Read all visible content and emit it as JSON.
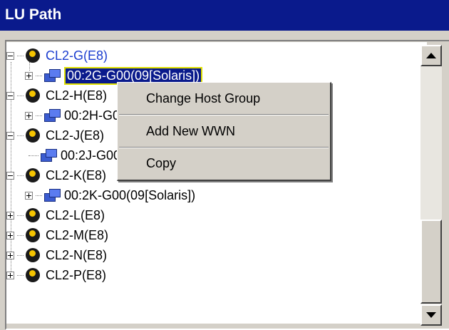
{
  "window": {
    "title": "LU Path"
  },
  "tree": {
    "nodes": [
      {
        "label": "CL2-G(E8)",
        "type": "port",
        "expander": "minus",
        "highlight": true
      },
      {
        "label": "00:2G-G00(09[Solaris])",
        "type": "host",
        "expander": "plus",
        "selected": true
      },
      {
        "label": "CL2-H(E8)",
        "type": "port",
        "expander": "minus"
      },
      {
        "label": "00:2H-G00(09[Solaris])",
        "type": "host",
        "expander": "plus"
      },
      {
        "label": "CL2-J(E8)",
        "type": "port",
        "expander": "minus"
      },
      {
        "label": "00:2J-G00(09[Solaris])",
        "type": "host",
        "expander": "none"
      },
      {
        "label": "CL2-K(E8)",
        "type": "port",
        "expander": "minus"
      },
      {
        "label": "00:2K-G00(09[Solaris])",
        "type": "host",
        "expander": "plus"
      },
      {
        "label": "CL2-L(E8)",
        "type": "port",
        "expander": "plus"
      },
      {
        "label": "CL2-M(E8)",
        "type": "port",
        "expander": "plus"
      },
      {
        "label": "CL2-N(E8)",
        "type": "port",
        "expander": "plus"
      },
      {
        "label": "CL2-P(E8)",
        "type": "port",
        "expander": "plus"
      }
    ]
  },
  "context_menu": {
    "items": [
      {
        "label": "Change Host Group"
      },
      {
        "label": "Add New WWN"
      },
      {
        "label": "Copy"
      }
    ]
  },
  "colors": {
    "title_bar": "#0a1a8c",
    "selection_border": "#e0e000",
    "highlight_text": "#1a3ccf",
    "port_icon": "#f5c400"
  },
  "icons": {
    "port": "port-icon",
    "host_group": "host-group-icon",
    "expand": "plus-box-icon",
    "collapse": "minus-box-icon"
  }
}
